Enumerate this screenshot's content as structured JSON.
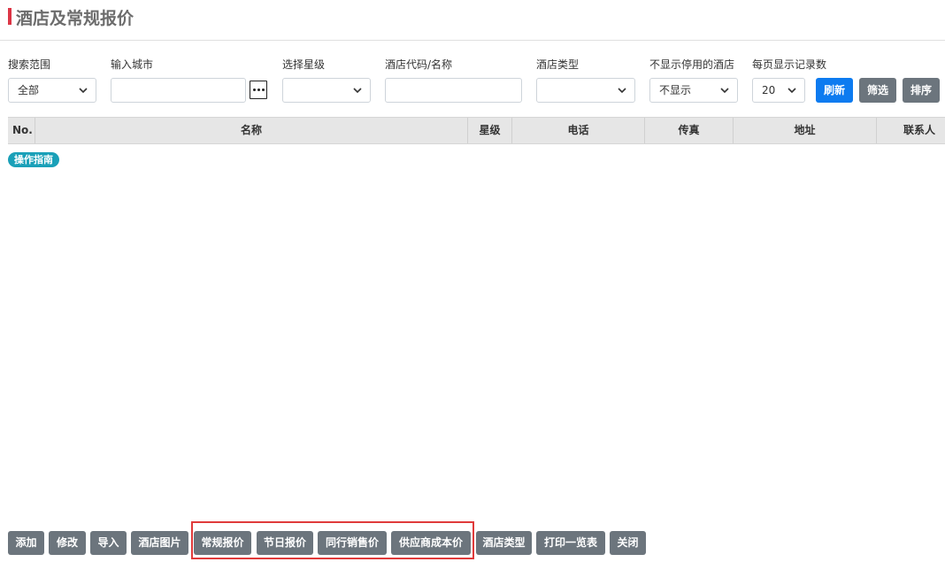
{
  "page": {
    "title": "酒店及常规报价"
  },
  "filters": {
    "search_scope": {
      "label": "搜索范围",
      "value": "全部"
    },
    "city": {
      "label": "输入城市",
      "value": ""
    },
    "star": {
      "label": "选择星级",
      "value": ""
    },
    "hotel_code": {
      "label": "酒店代码/名称",
      "value": ""
    },
    "hotel_type": {
      "label": "酒店类型",
      "value": ""
    },
    "hide_disabled": {
      "label": "不显示停用的酒店",
      "value": "不显示"
    },
    "page_size": {
      "label": "每页显示记录数",
      "value": "20"
    }
  },
  "actions": {
    "refresh": "刷新",
    "filter": "筛选",
    "sort": "排序"
  },
  "table": {
    "columns": [
      "No.",
      "名称",
      "星级",
      "电话",
      "传真",
      "地址",
      "联系人"
    ]
  },
  "guide": {
    "label": "操作指南"
  },
  "bottom_buttons": [
    "添加",
    "修改",
    "导入",
    "酒店图片",
    "常规报价",
    "节日报价",
    "同行销售价",
    "供应商成本价",
    "酒店类型",
    "打印一览表",
    "关闭"
  ],
  "colors": {
    "accent": "#dc3545",
    "primary": "#0d7bf0",
    "secondary": "#6c757d",
    "info": "#1aa0b8",
    "highlight": "#e03a3a"
  }
}
